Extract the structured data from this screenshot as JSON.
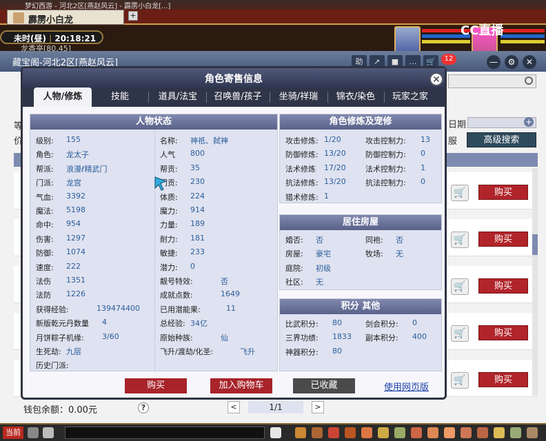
{
  "game": {
    "chat_tab": "霹雳小白龙",
    "top_garble": "梦幻西游  -  河北2区[燕赵风云]  -  霹雳小白龙[...]",
    "clock_period": "未时(昼)",
    "clock_time": "20:18:21",
    "subline": "龙香亭[80,45]",
    "cc_logo": "CC直播",
    "notification_count": "12"
  },
  "store": {
    "title": "藏宝阁-河北2区[燕赵风云]",
    "label_date": "日期",
    "label_server": "服",
    "left_frag1": "等",
    "left_frag2": "价",
    "advanced_search": "高级搜索",
    "buy_label": "购买",
    "wallet": "钱包余额：0.00元",
    "page": "1/1",
    "prev": "<",
    "next": ">",
    "help": "?"
  },
  "dialog": {
    "title": "角色寄售信息",
    "close": "✕",
    "tabs": [
      "人物/修炼",
      "技能",
      "道具/法宝",
      "召唤兽/孩子",
      "坐骑/祥瑞",
      "锦衣/染色",
      "玩家之家"
    ],
    "status_title": "人物状态",
    "status_left": [
      {
        "k": "级别:",
        "v": "155"
      },
      {
        "k": "角色:",
        "v": "龙太子"
      },
      {
        "k": "帮派:",
        "v": "浪漫ℓ精武门"
      },
      {
        "k": "门派:",
        "v": "龙宫"
      },
      {
        "k": "气血:",
        "v": "3392"
      },
      {
        "k": "魔法:",
        "v": "5198"
      },
      {
        "k": "命中:",
        "v": "954"
      },
      {
        "k": "伤害:",
        "v": "1297"
      },
      {
        "k": "防御:",
        "v": "1074"
      },
      {
        "k": "速度:",
        "v": "222"
      },
      {
        "k": "法伤",
        "v": "1351"
      },
      {
        "k": "法防",
        "v": "1226"
      },
      {
        "k": "获得经验:",
        "v": "139474400"
      },
      {
        "k": "新版乾元丹数量",
        "v": "4"
      },
      {
        "k": "月饼粽子机缘:",
        "v": "3/60"
      },
      {
        "k": "生死劫:",
        "v": "九层"
      },
      {
        "k": "历史门派:",
        "v": ""
      }
    ],
    "status_right": [
      {
        "k": "名称:",
        "v": "神祇、弑神"
      },
      {
        "k": "人气",
        "v": "800"
      },
      {
        "k": "帮贡:",
        "v": "35"
      },
      {
        "k": "门贡:",
        "v": "230"
      },
      {
        "k": "体质:",
        "v": "224"
      },
      {
        "k": "魔力:",
        "v": "914"
      },
      {
        "k": "力量:",
        "v": "189"
      },
      {
        "k": "耐力:",
        "v": "181"
      },
      {
        "k": "敏捷:",
        "v": "233"
      },
      {
        "k": "潜力:",
        "v": "0"
      },
      {
        "k": "靓号特效:",
        "v": "否"
      },
      {
        "k": "成就点数:",
        "v": "1649"
      },
      {
        "k": "已用潜能果:",
        "v": "11"
      },
      {
        "k": "总经验:",
        "v": "34亿"
      },
      {
        "k": "原始种族:",
        "v": "仙"
      },
      {
        "k": "飞升/渡劫/化圣:",
        "v": "飞升"
      }
    ],
    "cultivation_title": "角色修炼及宠修",
    "cultivation_left": [
      {
        "k": "攻击修炼:",
        "v": "1/20"
      },
      {
        "k": "防御修炼:",
        "v": "13/20"
      },
      {
        "k": "法术修炼",
        "v": "17/20"
      },
      {
        "k": "抗法修炼:",
        "v": "13/20"
      },
      {
        "k": "猎术修炼:",
        "v": "1"
      }
    ],
    "cultivation_right": [
      {
        "k": "攻击控制力:",
        "v": "13"
      },
      {
        "k": "防御控制力:",
        "v": "0"
      },
      {
        "k": "法术控制力:",
        "v": "1"
      },
      {
        "k": "抗法控制力:",
        "v": "0"
      }
    ],
    "house_title": "居住房屋",
    "house_left": [
      {
        "k": "婚否:",
        "v": "否"
      },
      {
        "k": "房屋:",
        "v": "豪宅"
      },
      {
        "k": "庭院:",
        "v": "初级"
      },
      {
        "k": "社区:",
        "v": "无"
      }
    ],
    "house_right": [
      {
        "k": "同袍:",
        "v": "否"
      },
      {
        "k": "牧场:",
        "v": "无"
      }
    ],
    "score_title": "积分 其他",
    "score_left": [
      {
        "k": "比武积分:",
        "v": "80"
      },
      {
        "k": "三界功绩:",
        "v": "1833"
      },
      {
        "k": "神器积分:",
        "v": "80"
      }
    ],
    "score_right": [
      {
        "k": "剑会积分:",
        "v": "0"
      },
      {
        "k": "副本积分:",
        "v": "400"
      }
    ],
    "btn_buy": "购买",
    "btn_cart": "加入购物车",
    "btn_fav": "已收藏",
    "web_link": "使用网页版"
  },
  "bottom": {
    "current": "当前"
  },
  "colors": {
    "accent_blue": "#2a5e9c",
    "buy_red": "#b0242a",
    "header_navy": "#303752"
  }
}
